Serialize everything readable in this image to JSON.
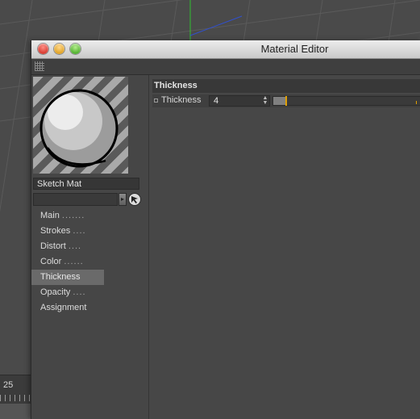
{
  "window": {
    "title": "Material Editor"
  },
  "material": {
    "name": "Sketch Mat"
  },
  "nav": {
    "items": [
      {
        "label": "Main",
        "dots": ".......",
        "active": false
      },
      {
        "label": "Strokes",
        "dots": "....",
        "active": false
      },
      {
        "label": "Distort",
        "dots": "....",
        "active": false
      },
      {
        "label": "Color",
        "dots": "......",
        "active": false
      },
      {
        "label": "Thickness",
        "dots": "",
        "active": true
      },
      {
        "label": "Opacity",
        "dots": "....",
        "active": false
      },
      {
        "label": "Assignment",
        "dots": "",
        "active": false
      }
    ]
  },
  "section": {
    "header": "Thickness",
    "param": {
      "label": "Thickness",
      "value": "4",
      "slider_fraction": 0.08
    }
  },
  "timeline": {
    "frame_label": "25"
  },
  "colors": {
    "accent": "#e0a000",
    "panel": "#474747",
    "active_nav": "#6a6a6a"
  },
  "icons": {
    "layer_arrow": "triangle-right-icon",
    "pick": "pick-arrow-icon",
    "grip": "grip-icon",
    "anim_dot": "animation-dot-icon",
    "spin": "stepper-arrows-icon"
  }
}
